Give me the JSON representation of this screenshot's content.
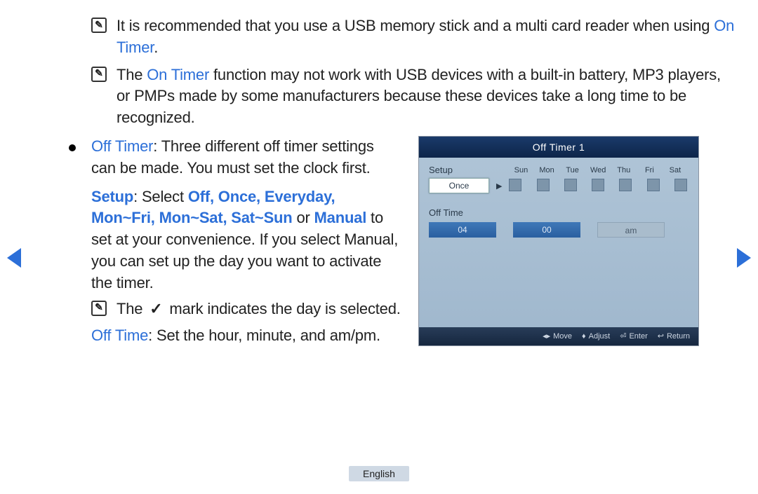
{
  "notes": {
    "n1_a": "It is recommended that you use a USB memory stick and a multi card reader when using ",
    "n1_link": "On Timer",
    "n1_b": ".",
    "n2_a": "The ",
    "n2_link": "On Timer",
    "n2_b": " function may not work with USB devices with a built-in battery, MP3 players, or PMPs made by some manufacturers because these devices take a long time to be recognized."
  },
  "bullet": {
    "off_timer_label": "Off Timer",
    "off_timer_desc": ": Three different off timer settings can be made. You must set the clock first.",
    "setup_label": "Setup",
    "setup_mid": ": Select ",
    "setup_opts": "Off, Once, Everyday, Mon~Fri, Mon~Sat, Sat~Sun",
    "setup_or": " or ",
    "setup_manual": "Manual",
    "setup_tail": " to set at your convenience. If you select Manual, you can set up the day you want to activate the timer.",
    "mark_a": "The ",
    "mark_b": " mark indicates the day is selected.",
    "offtime_label": "Off Time",
    "offtime_desc": ": Set the hour, minute, and am/pm."
  },
  "osd": {
    "title": "Off Timer 1",
    "setup_label": "Setup",
    "setup_value": "Once",
    "days": [
      "Sun",
      "Mon",
      "Tue",
      "Wed",
      "Thu",
      "Fri",
      "Sat"
    ],
    "offtime_label": "Off Time",
    "hour": "04",
    "minute": "00",
    "ampm": "am",
    "footer": {
      "move": "Move",
      "adjust": "Adjust",
      "enter": "Enter",
      "return": "Return"
    }
  },
  "language": "English"
}
